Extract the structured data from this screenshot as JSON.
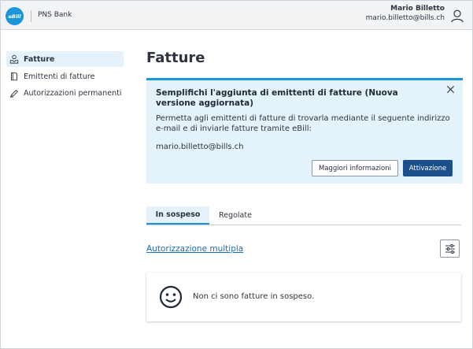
{
  "header": {
    "logo_text": "eBill",
    "bank_name": "PNS Bank",
    "user_name": "Mario Billetto",
    "user_email": "mario.billetto@bills.ch",
    "user_icon": "user-icon"
  },
  "sidebar": {
    "items": [
      {
        "label": "Fatture",
        "icon": "bills-icon",
        "active": true
      },
      {
        "label": "Emittenti di fatture",
        "icon": "document-icon",
        "active": false
      },
      {
        "label": "Autorizzazioni permanenti",
        "icon": "signature-icon",
        "active": false
      }
    ]
  },
  "main": {
    "title": "Fatture",
    "banner": {
      "title": "Semplifichi l'aggiunta di emittenti di fatture (Nuova versione aggiornata)",
      "text": "Permetta agli emittenti di fatture di trovarla mediante il seguente indirizzo e-mail e di inviarle fatture tramite eBill:",
      "email": "mario.billetto@bills.ch",
      "more_label": "Maggiori informazioni",
      "activate_label": "Attivazione",
      "accent_color": "#1c96d8",
      "background_color": "#e3f2fb"
    },
    "tabs": [
      {
        "label": "In sospeso",
        "active": true
      },
      {
        "label": "Regolate",
        "active": false
      }
    ],
    "multi_auth_link": "Autorizzazione multipla",
    "filter_icon": "filter-sliders-icon",
    "empty_state": {
      "icon": "smiley-icon",
      "text": "Non ci sono fatture in sospeso."
    }
  },
  "colors": {
    "primary_button": "#1b4f8b",
    "link": "#1c6fb8",
    "brand": "#1c96d8"
  }
}
